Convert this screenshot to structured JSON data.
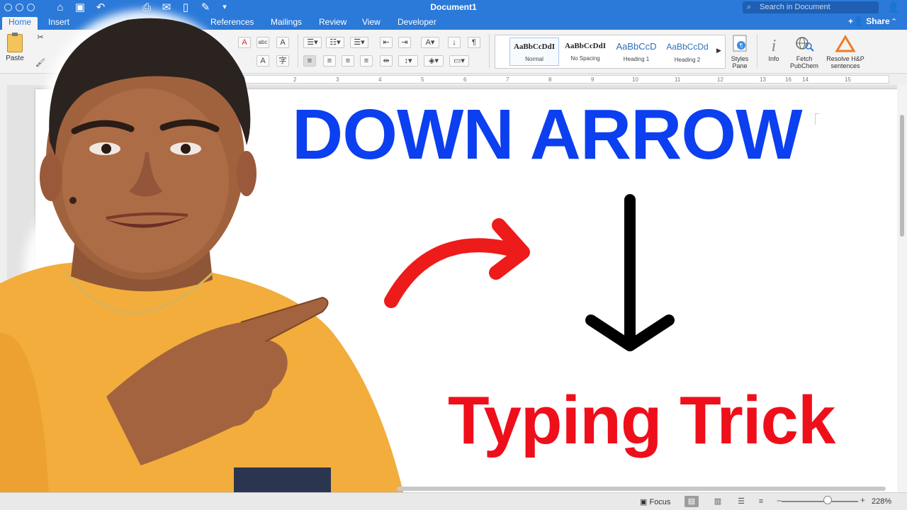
{
  "window": {
    "title": "Document1",
    "search_placeholder": "Search in Document",
    "share_label": "Share"
  },
  "tabs": [
    "Home",
    "Insert",
    "References",
    "Mailings",
    "Review",
    "View",
    "Developer"
  ],
  "ribbon": {
    "paste_label": "Paste",
    "styles": [
      {
        "preview": "AaBbCcDdI",
        "name": "Normal"
      },
      {
        "preview": "AaBbCcDdI",
        "name": "No Spacing"
      },
      {
        "preview": "AaBbCcD",
        "name": "Heading 1"
      },
      {
        "preview": "AaBbCcDd",
        "name": "Heading 2"
      }
    ],
    "styles_pane_label": "Styles\nPane",
    "info_label": "Info",
    "fetch_label": "Fetch\nPubChem",
    "resolve_label": "Resolve H&P\nsentences"
  },
  "ruler_ticks": [
    "2",
    "3",
    "4",
    "5",
    "6",
    "7",
    "8",
    "9",
    "10",
    "11",
    "12",
    "13",
    "14",
    "15",
    "16"
  ],
  "document": {
    "headline": "DOWN ARROW",
    "subline": "Typing Trick",
    "arrow_glyph": "↓",
    "headline_color": "#0b3ff0",
    "subline_color": "#ee0f1b"
  },
  "status": {
    "focus_label": "Focus",
    "zoom": "228%"
  },
  "colors": {
    "titlebar": "#2b79d8",
    "ribbon": "#f3f3f3",
    "curved_arrow": "#ee1b1b"
  }
}
